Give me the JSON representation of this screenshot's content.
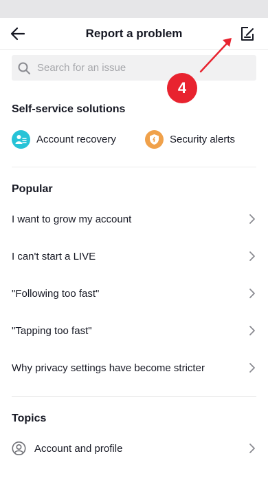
{
  "header": {
    "title": "Report a problem"
  },
  "search": {
    "placeholder": "Search for an issue"
  },
  "annotation": {
    "badge": "4"
  },
  "self_service": {
    "title": "Self-service solutions",
    "items": [
      {
        "label": "Account recovery",
        "icon": "account-recovery-icon",
        "color": "#27c3d7"
      },
      {
        "label": "Security alerts",
        "icon": "shield-icon",
        "color": "#f0a14a"
      }
    ]
  },
  "popular": {
    "title": "Popular",
    "items": [
      {
        "label": "I want to grow my account"
      },
      {
        "label": "I can't start a LIVE"
      },
      {
        "label": "\"Following too fast\""
      },
      {
        "label": "\"Tapping too fast\""
      },
      {
        "label": "Why privacy settings have become stricter"
      }
    ]
  },
  "topics": {
    "title": "Topics",
    "items": [
      {
        "label": "Account and profile",
        "icon": "user-circle-icon"
      }
    ]
  },
  "colors": {
    "accent": "#e8232f",
    "text": "#161823",
    "muted": "#a6a7ab"
  }
}
